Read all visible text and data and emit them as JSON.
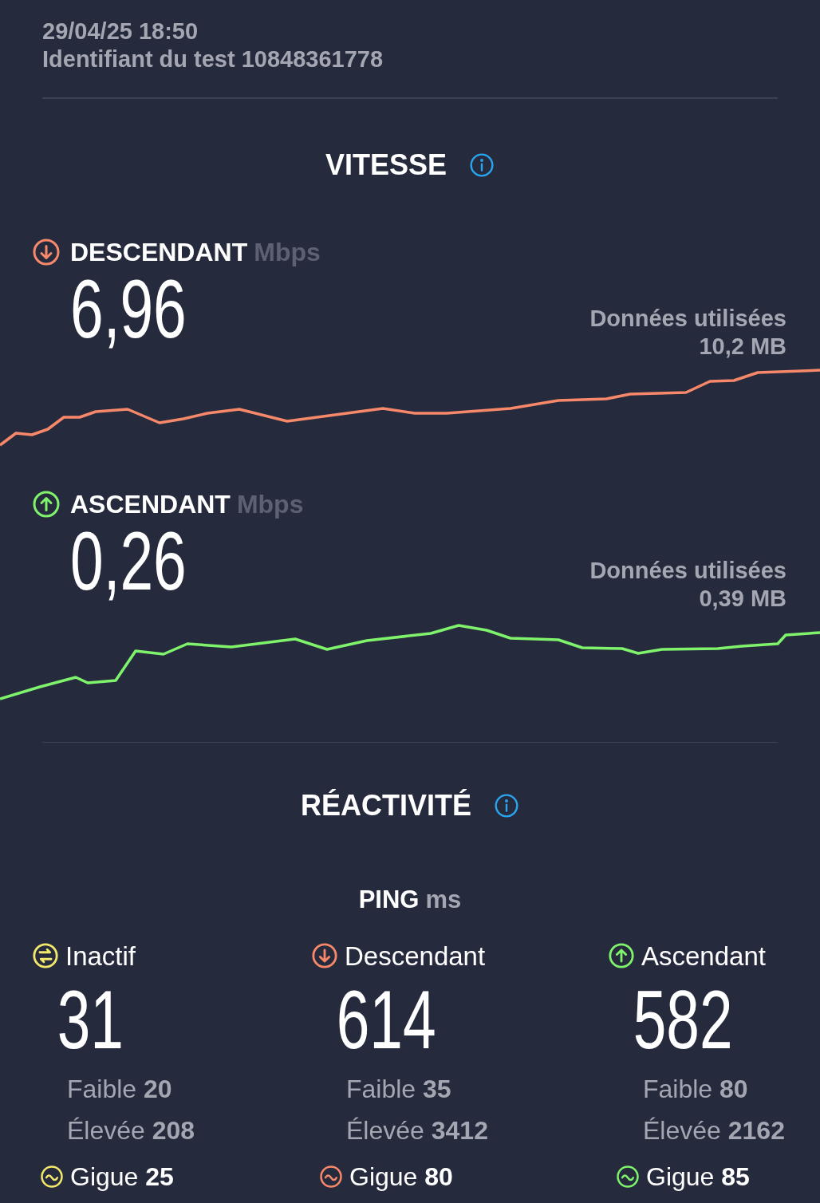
{
  "header": {
    "date": "29/04/25 18:50",
    "test_id": "Identifiant du test 10848361778"
  },
  "speed": {
    "title": "VITESSE",
    "sections": [
      {
        "kind": "download",
        "label": "DESCENDANT",
        "unit": "Mbps",
        "value": "6,96",
        "data_label": "Données utilisées",
        "data_value": "10,2 MB"
      },
      {
        "kind": "upload",
        "label": "ASCENDANT",
        "unit": "Mbps",
        "value": "0,26",
        "data_label": "Données utilisées",
        "data_value": "0,39 MB"
      }
    ]
  },
  "reactivity": {
    "title": "RÉACTIVITÉ",
    "ping_label": "PING",
    "ping_unit": "ms",
    "columns": [
      {
        "kind": "idle",
        "label": "Inactif",
        "value": "31",
        "low": "Faible **20**",
        "high": "Élevée **208**",
        "jitter": "Gigue **25**"
      },
      {
        "kind": "download",
        "label": "Descendant",
        "value": "614",
        "low": "Faible **35**",
        "high": "Élevée **3412**",
        "jitter": "Gigue **80**"
      },
      {
        "kind": "upload",
        "label": "Ascendant",
        "value": "582",
        "low": "Faible **80**",
        "high": "Élevée **2162**",
        "jitter": "Gigue **85**"
      }
    ]
  }
}
